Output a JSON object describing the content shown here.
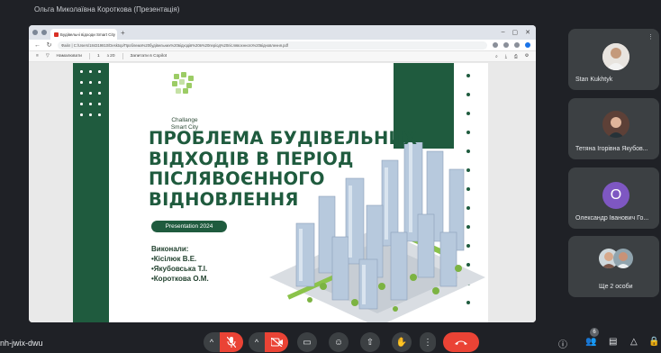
{
  "presenter_label": "Ольга Миколаївна Короткова (Презентація)",
  "browser": {
    "tab_title": "Будівельні відходи Smart City",
    "url": "Файл | C:/Users/184319810/Desktop/Проблема%20будівельних%20відходів%20в%20період%20післявоєнного%20відновлення.pdf",
    "pdf_toolbar": {
      "list": "Намалювати",
      "page": "1",
      "of_pages": "з 20",
      "read": "Запитати в Copilot"
    }
  },
  "slide": {
    "logo_text_line1": "Challange",
    "logo_text_line2": "Smart City",
    "title_lines": [
      "ПРОБЛЕМА БУДІВЕЛЬНИХ",
      "ВІДХОДІВ В ПЕРІОД",
      "ПІСЛЯВОЄННОГО",
      "ВІДНОВЛЕННЯ"
    ],
    "presentation_pill": "Presentation 2024",
    "authors_heading": "Виконали:",
    "authors": [
      "•Кісілюк В.Е.",
      "•Якубовська Т.І.",
      "•Короткова О.М."
    ],
    "colors": {
      "green": "#1f5b3e",
      "light_green": "#9ccc65"
    }
  },
  "participants": [
    {
      "name": "Stan Kukhtyk",
      "avatar": "photo"
    },
    {
      "name": "Тетяна Ігорівна Якубов...",
      "avatar": "photo"
    },
    {
      "name": "Олександр Іванович Го...",
      "avatar_letter": "О",
      "avatar_color": "#7e57c2"
    },
    {
      "name": "Ще 2 особи",
      "avatar": "group"
    }
  ],
  "meeting_code": "nh-jwix-dwu",
  "toolbar": {
    "mic_icon": "mic-off-icon",
    "camera_icon": "camera-off-icon",
    "participant_count": "6",
    "colors": {
      "control": "#3c4043",
      "danger": "#ea4335"
    }
  }
}
